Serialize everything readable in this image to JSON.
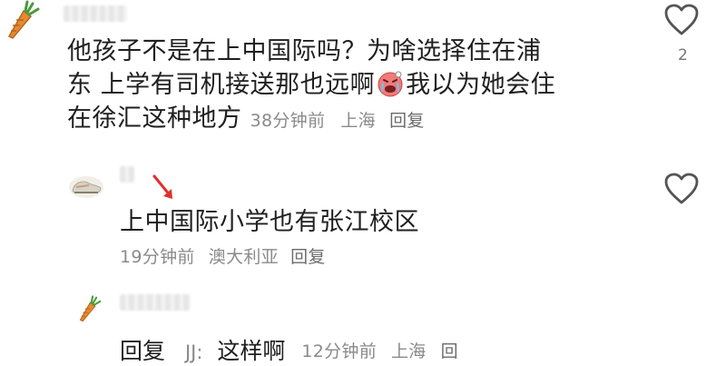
{
  "comment1": {
    "text_line1": "他孩子不是在上中国际吗？为啥选择住在浦",
    "text_line2_a": "东 上学有司机接送那也远啊",
    "text_line2_b": "我以为她会住",
    "text_line3": "在徐汇这种地方",
    "time": "38分钟前",
    "location": "上海",
    "reply_label": "回复",
    "like_count": "2",
    "avatar_icon": "carrot-icon"
  },
  "comment2": {
    "text": "上中国际小学也有张江校区",
    "time": "19分钟前",
    "location": "澳大利亚",
    "reply_label": "回复",
    "avatar_icon": "sneaker-avatar-icon"
  },
  "comment3": {
    "reply_label": "回复",
    "to_name": "JJ:",
    "text": "这样啊",
    "time": "12分钟前",
    "location": "上海",
    "reply_link": "回",
    "avatar_icon": "carrot-icon"
  },
  "colors": {
    "arrow": "#e0312b",
    "meta_text": "#8a8a8a",
    "body_text": "#1f1f1f"
  }
}
